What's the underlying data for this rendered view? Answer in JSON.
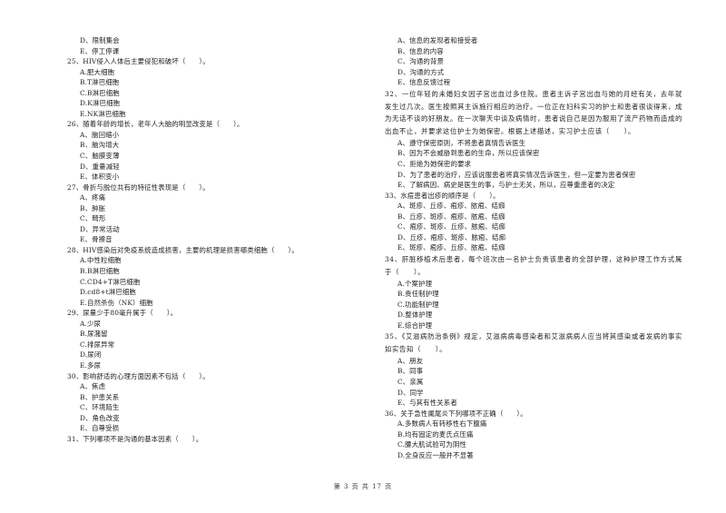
{
  "left_column": [
    {
      "type": "opt",
      "text": "D、限制集会"
    },
    {
      "type": "opt",
      "text": "E、停工停课"
    },
    {
      "type": "q",
      "text": "25、HIV侵入人体后主要侵犯和破坏（　　）。"
    },
    {
      "type": "opt",
      "text": "A.肥大细胞"
    },
    {
      "type": "opt",
      "text": "B.T淋巴细胞"
    },
    {
      "type": "opt",
      "text": "C.B淋巴细胞"
    },
    {
      "type": "opt",
      "text": "D.K淋巴细胞"
    },
    {
      "type": "opt",
      "text": "E.NK淋巴细胞"
    },
    {
      "type": "q",
      "text": "26、随着年龄的增长，老年人大脑的明显改变是（　　）。"
    },
    {
      "type": "opt",
      "text": "A、脑回缩小"
    },
    {
      "type": "opt",
      "text": "B、脑沟增大"
    },
    {
      "type": "opt",
      "text": "C、脑膜变薄"
    },
    {
      "type": "opt",
      "text": "D、重量减轻"
    },
    {
      "type": "opt",
      "text": "E、体积变小"
    },
    {
      "type": "q",
      "text": "27、骨折与脱位共有的特征性表现是（　　）。"
    },
    {
      "type": "opt",
      "text": "A、疼痛"
    },
    {
      "type": "opt",
      "text": "B、肿胀"
    },
    {
      "type": "opt",
      "text": "C、畸形"
    },
    {
      "type": "opt",
      "text": "D、异常活动"
    },
    {
      "type": "opt",
      "text": "E、骨擦音"
    },
    {
      "type": "q",
      "text": "28、HIV感染后对免疫系统造成损害，主要的机理是损害哪类细胞（　　）。"
    },
    {
      "type": "opt",
      "text": "A.中性粒细胞"
    },
    {
      "type": "opt",
      "text": "B.B淋巴细胞"
    },
    {
      "type": "opt",
      "text": "C.CD4+T淋巴细胞"
    },
    {
      "type": "opt",
      "text": "D.cd8+t淋巴细胞"
    },
    {
      "type": "opt",
      "text": "E.自然杀伤（NK）细胞"
    },
    {
      "type": "q",
      "text": "29、尿量少于80毫升属于（　　）。"
    },
    {
      "type": "opt",
      "text": "A.少尿"
    },
    {
      "type": "opt",
      "text": "B.尿潴留"
    },
    {
      "type": "opt",
      "text": "C.排尿异常"
    },
    {
      "type": "opt",
      "text": "D.尿闭"
    },
    {
      "type": "opt",
      "text": "E.多尿"
    },
    {
      "type": "q",
      "text": "30、影响舒适的心理方面因素不包括（　　）。"
    },
    {
      "type": "opt",
      "text": "A、焦虑"
    },
    {
      "type": "opt",
      "text": "B、护患关系"
    },
    {
      "type": "opt",
      "text": "C、环境陌生"
    },
    {
      "type": "opt",
      "text": "D、角色改变"
    },
    {
      "type": "opt",
      "text": "E、自尊受损"
    },
    {
      "type": "q",
      "text": "31、下列哪项不是沟通的基本因素（　　）。"
    }
  ],
  "right_column": [
    {
      "type": "opt",
      "text": "A、信息的发现者和接受者"
    },
    {
      "type": "opt",
      "text": "B、信息的内容"
    },
    {
      "type": "opt",
      "text": "C、沟通的背景"
    },
    {
      "type": "opt",
      "text": "D、沟通的方式"
    },
    {
      "type": "opt",
      "text": "E、信息反馈过程"
    },
    {
      "type": "qwrap",
      "text": "32、一位年轻的未婚妇女因子宫出血过多住院。患者主诉子宫出血与她的月经有关，去年就发生过几次。医生按照其主诉施行相应的治疗。一位正在妇科实习的护士和患者很谈得来，成为无话不谈的好朋友。在一次聊天中谈及病情时，患者说自己是因为服用了流产药物而造成的出血不止，并要求这位护士为她保密。根据上述描述，实习护士应该（　　）。"
    },
    {
      "type": "opt",
      "text": "A、遵守保密原则，不将患者真情告诉医生"
    },
    {
      "type": "opt",
      "text": "B、因为不会威胁到患者的生命，所以应该保密"
    },
    {
      "type": "opt",
      "text": "C、拒绝为她保密的要求"
    },
    {
      "type": "opt",
      "text": "D、为了患者的治疗，应该说服患者将真实情况告诉医生，但一定要为患者保密"
    },
    {
      "type": "opt",
      "text": "E、了解病因、病史是医生的事，与护士无关，所以，应尊重患者的决定"
    },
    {
      "type": "q",
      "text": "33、水痘患者出疹的顺序是（　　）。"
    },
    {
      "type": "opt",
      "text": "A、斑疹、丘疹、疱疹、脓疱、结痂"
    },
    {
      "type": "opt",
      "text": "B、丘疹、斑疹、疱疹、脓疱、结痂"
    },
    {
      "type": "opt",
      "text": "C、疱疹、斑疹、丘疹、脓疱、结痂"
    },
    {
      "type": "opt",
      "text": "D、丘疹、疱疹、斑疹、脓疱、结痂"
    },
    {
      "type": "opt",
      "text": "E、斑疹、疱疹、丘疹、脓疱、结痂"
    },
    {
      "type": "qwrap",
      "text": "34、肝脏移植术后患者，每个班次由一名护士负责该患者的全部护理，这种护理工作方式属于（　　）。"
    },
    {
      "type": "opt",
      "text": "A.个案护理"
    },
    {
      "type": "opt",
      "text": "B.责任制护理"
    },
    {
      "type": "opt",
      "text": "C.功能制护理"
    },
    {
      "type": "opt",
      "text": "D.整体护理"
    },
    {
      "type": "opt",
      "text": "E.综合护理"
    },
    {
      "type": "qwrap",
      "text": "35、《艾滋病防治条例》规定，艾滋病病毒感染者和艾滋病病人应当将其感染或者发病的事实如实告知（　　）。"
    },
    {
      "type": "opt",
      "text": "A、朋友"
    },
    {
      "type": "opt",
      "text": "B、同事"
    },
    {
      "type": "opt",
      "text": "C、亲属"
    },
    {
      "type": "opt",
      "text": "D、同学"
    },
    {
      "type": "opt",
      "text": "E、与其有性关系者"
    },
    {
      "type": "q",
      "text": "36、关于急性阑尾炎下列哪项不正确（　　）。"
    },
    {
      "type": "opt",
      "text": "A.多数病人有转移性右下腹痛"
    },
    {
      "type": "opt",
      "text": "B.均有固定的麦氏点压痛"
    },
    {
      "type": "opt",
      "text": "C.腰大肌试验可为阴性"
    },
    {
      "type": "opt",
      "text": "D.全身反应一般并不显著"
    }
  ],
  "footer": {
    "page_label": "第 3 页 共 17 页"
  }
}
